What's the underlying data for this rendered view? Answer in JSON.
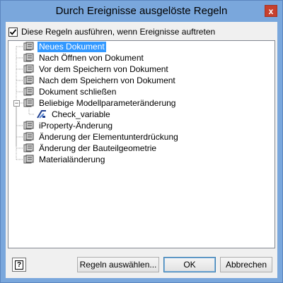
{
  "window": {
    "title": "Durch Ereignisse ausgelöste Regeln",
    "close_glyph": "x"
  },
  "checkbox": {
    "label": "Diese Regeln ausführen, wenn Ereignisse auftreten",
    "checked": true
  },
  "tree": {
    "items": [
      {
        "label": "Neues Dokument",
        "selected": true,
        "level": 0
      },
      {
        "label": "Nach Öffnen von Dokument",
        "level": 0
      },
      {
        "label": "Vor dem Speichern von Dokument",
        "level": 0
      },
      {
        "label": "Nach dem Speichern von Dokument",
        "level": 0
      },
      {
        "label": "Dokument schließen",
        "level": 0
      },
      {
        "label": "Beliebige Modellparameteränderung",
        "level": 0,
        "expanded": true
      },
      {
        "label": "Check_variable",
        "level": 1,
        "icon": "rule-icon"
      },
      {
        "label": "iProperty-Änderung",
        "level": 0
      },
      {
        "label": "Änderung der Elementunterdrückung",
        "level": 0
      },
      {
        "label": "Änderung der Bauteilgeometrie",
        "level": 0
      },
      {
        "label": "Materialänderung",
        "level": 0
      }
    ],
    "collapse_glyph": "−"
  },
  "buttons": {
    "help": "?",
    "select_rules": "Regeln auswählen...",
    "ok": "OK",
    "cancel": "Abbrechen"
  },
  "colors": {
    "titlebar": "#7aa7dc",
    "selection": "#3399ff",
    "close": "#c7402d"
  }
}
